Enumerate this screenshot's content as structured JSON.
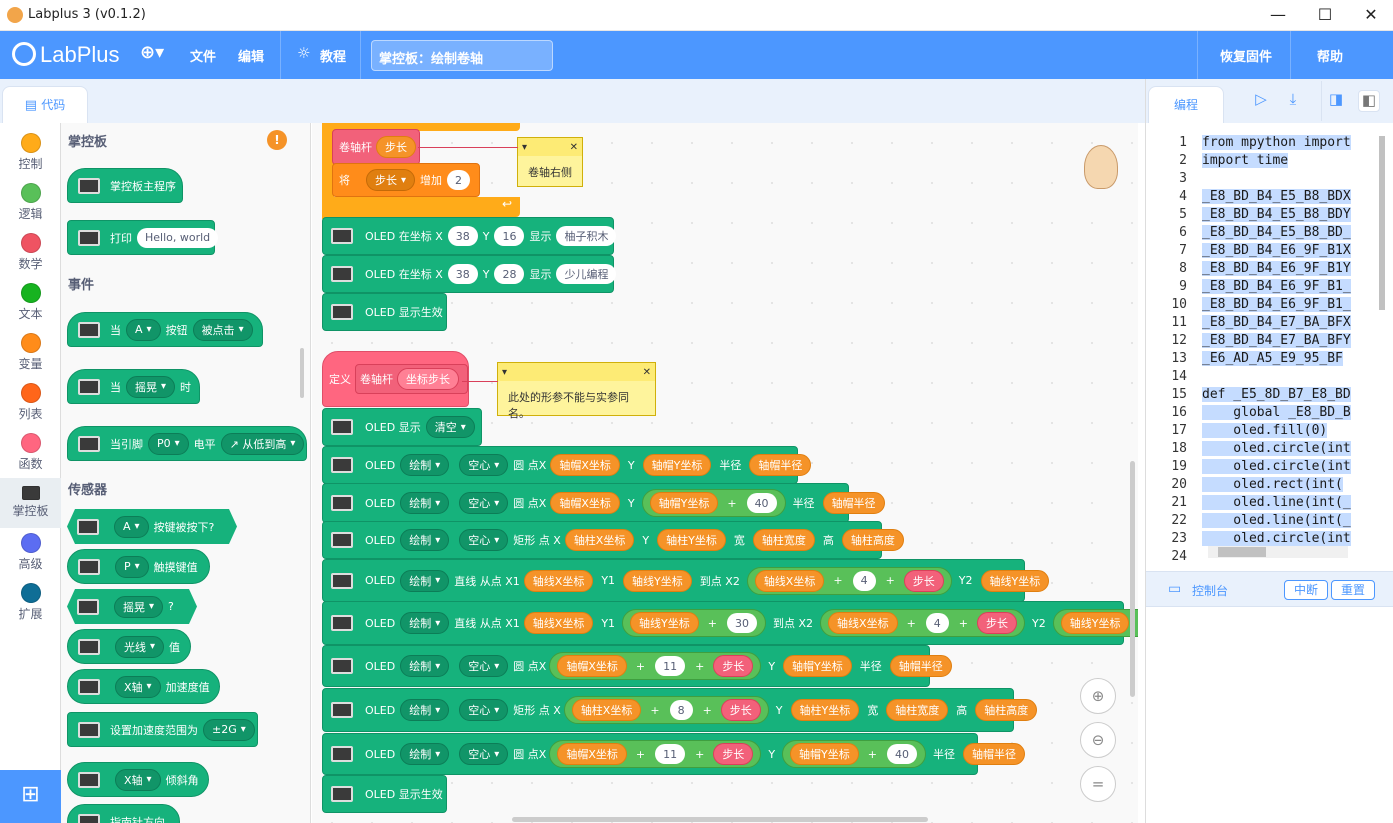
{
  "window": {
    "title": "Labplus 3 (v0.1.2)"
  },
  "menubar": {
    "logo": "LabPlus",
    "file": "文件",
    "edit": "编辑",
    "tutorial": "教程",
    "project_title": "掌控板：绘制卷轴",
    "restore_firmware": "恢复固件",
    "help": "帮助"
  },
  "tabs": {
    "code": "代码",
    "programming": "编程"
  },
  "categories": [
    {
      "label": "控制",
      "color": "#ffab19"
    },
    {
      "label": "逻辑",
      "color": "#59c059"
    },
    {
      "label": "数学",
      "color": "#ef5362"
    },
    {
      "label": "文本",
      "color": "#17b320"
    },
    {
      "label": "变量",
      "color": "#ff8c1a"
    },
    {
      "label": "列表",
      "color": "#ff661a"
    },
    {
      "label": "函数",
      "color": "#ff6680"
    },
    {
      "label": "掌控板",
      "color": "#3a3a3a"
    },
    {
      "label": "高级",
      "color": "#5c6df2"
    },
    {
      "label": "扩展",
      "color": "#0f6e96"
    }
  ],
  "flyout": {
    "title_main": "掌控板",
    "main_program": "掌控板主程序",
    "print_label": "打印",
    "print_value": "Hello, world",
    "title_events": "事件",
    "when": "当",
    "button_a": "A",
    "button_label": "按钮",
    "clicked": "被点击",
    "shake": "摇晃",
    "when_suffix": "时",
    "pin_when": "当引脚",
    "pin": "P0",
    "level": "电平",
    "rising": "↗ 从低到高",
    "title_sensors": "传感器",
    "btn_pressed": "按键被按下?",
    "touch_p": "P",
    "touch_label": "触摸键值",
    "shake2": "摇晃",
    "question": "?",
    "light": "光线",
    "value": "值",
    "axis_x": "X轴",
    "accel": "加速度值",
    "set_accel": "设置加速度范围为",
    "accel_range": "±2G",
    "axis_x2": "X轴",
    "tilt": "倾斜角",
    "compass": "指南针方向"
  },
  "workspace": {
    "scroll_label": "卷轴杆",
    "step": "步长",
    "set": "将",
    "step_var": "步长",
    "increase": "增加",
    "step_inc": "2",
    "comment1": "卷轴右侧",
    "oled_at": "OLED 在坐标 X",
    "y": "Y",
    "show": "显示",
    "x1": "38",
    "y1": "16",
    "text1": "柚子积木",
    "x2": "38",
    "y2": "28",
    "text2": "少儿编程",
    "oled_apply": "OLED 显示生效",
    "define": "定义",
    "param": "坐标步长",
    "comment2": "此处的形参不能与实参同名。",
    "oled_show": "OLED 显示",
    "clear": "清空",
    "oled": "OLED",
    "draw": "绘制",
    "hollow": "空心",
    "circle_x": "圆 点X",
    "rect_x": "矩形 点 X",
    "line_x1": "直线 从点 X1",
    "y1_lbl": "Y1",
    "to_x2": "到点 X2",
    "y2_lbl": "Y2",
    "radius": "半径",
    "width": "宽",
    "height": "高",
    "cap_x": "轴帽X坐标",
    "cap_y": "轴帽Y坐标",
    "cap_r": "轴帽半径",
    "rod_x": "轴柱X坐标",
    "rod_y": "轴柱Y坐标",
    "rod_w": "轴柱宽度",
    "rod_h": "轴柱高度",
    "line_x": "轴线X坐标",
    "line_y": "轴线Y坐标",
    "plus": "+",
    "n40": "40",
    "n4": "4",
    "n30": "30",
    "n11": "11",
    "n8": "8"
  },
  "code": {
    "lines": [
      {
        "n": "1",
        "t": "from mpython import"
      },
      {
        "n": "2",
        "t": "import time"
      },
      {
        "n": "3",
        "t": ""
      },
      {
        "n": "4",
        "t": "_E8_BD_B4_E5_B8_BDX"
      },
      {
        "n": "5",
        "t": "_E8_BD_B4_E5_B8_BDY"
      },
      {
        "n": "6",
        "t": "_E8_BD_B4_E5_B8_BD_"
      },
      {
        "n": "7",
        "t": "_E8_BD_B4_E6_9F_B1X"
      },
      {
        "n": "8",
        "t": "_E8_BD_B4_E6_9F_B1Y"
      },
      {
        "n": "9",
        "t": "_E8_BD_B4_E6_9F_B1_"
      },
      {
        "n": "10",
        "t": "_E8_BD_B4_E6_9F_B1_"
      },
      {
        "n": "11",
        "t": "_E8_BD_B4_E7_BA_BFX"
      },
      {
        "n": "12",
        "t": "_E8_BD_B4_E7_BA_BFY"
      },
      {
        "n": "13",
        "t": "_E6_AD_A5_E9_95_BF"
      },
      {
        "n": "14",
        "t": ""
      },
      {
        "n": "15",
        "t": "def _E5_8D_B7_E8_BD"
      },
      {
        "n": "16",
        "t": "    global _E8_BD_B"
      },
      {
        "n": "17",
        "t": "    oled.fill(0)"
      },
      {
        "n": "18",
        "t": "    oled.circle(int"
      },
      {
        "n": "19",
        "t": "    oled.circle(int"
      },
      {
        "n": "20",
        "t": "    oled.rect(int("
      },
      {
        "n": "21",
        "t": "    oled.line(int(_"
      },
      {
        "n": "22",
        "t": "    oled.line(int(_"
      },
      {
        "n": "23",
        "t": "    oled.circle(int"
      },
      {
        "n": "24",
        "t": ""
      }
    ]
  },
  "console": {
    "label": "控制台",
    "interrupt": "中断",
    "reset": "重置"
  }
}
